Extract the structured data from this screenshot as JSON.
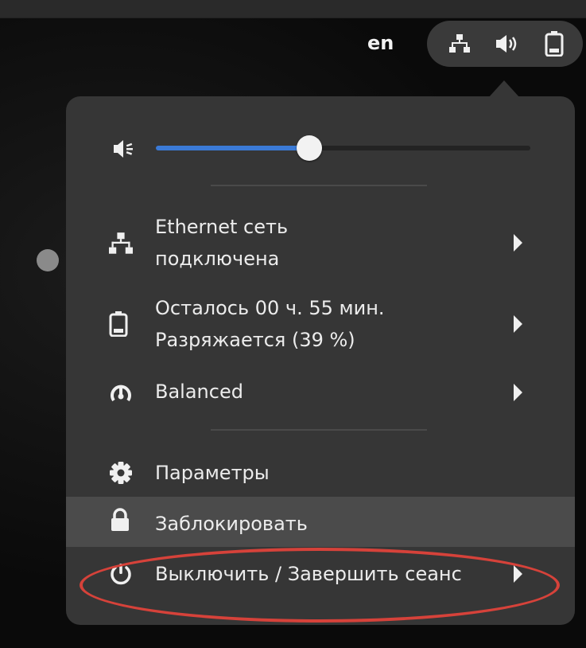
{
  "topbar": {
    "language": "en",
    "indicators": [
      "network-wired-icon",
      "audio-volume-icon",
      "battery-icon"
    ]
  },
  "volume": {
    "icon": "volume-low-icon",
    "level": 0.41
  },
  "menu": {
    "items": [
      {
        "icon": "network-wired-icon",
        "line1": "Ethernet сеть",
        "line2": "подключена",
        "has_submenu": true
      },
      {
        "icon": "battery-icon",
        "line1": "Осталось 00 ч. 55 мин.",
        "line2": "Разряжается (39 %)",
        "has_submenu": true
      },
      {
        "icon": "power-profile-icon",
        "label": "Balanced",
        "has_submenu": true
      },
      {
        "icon": "settings-gear-icon",
        "label": "Параметры",
        "has_submenu": false
      },
      {
        "icon": "lock-icon",
        "label": "Заблокировать",
        "has_submenu": false,
        "highlighted": true
      },
      {
        "icon": "power-icon",
        "label": "Выключить / Завершить сеанс",
        "has_submenu": true
      }
    ]
  },
  "colors": {
    "slider_accent": "#3b7ad6",
    "annotation": "#d6423a"
  }
}
